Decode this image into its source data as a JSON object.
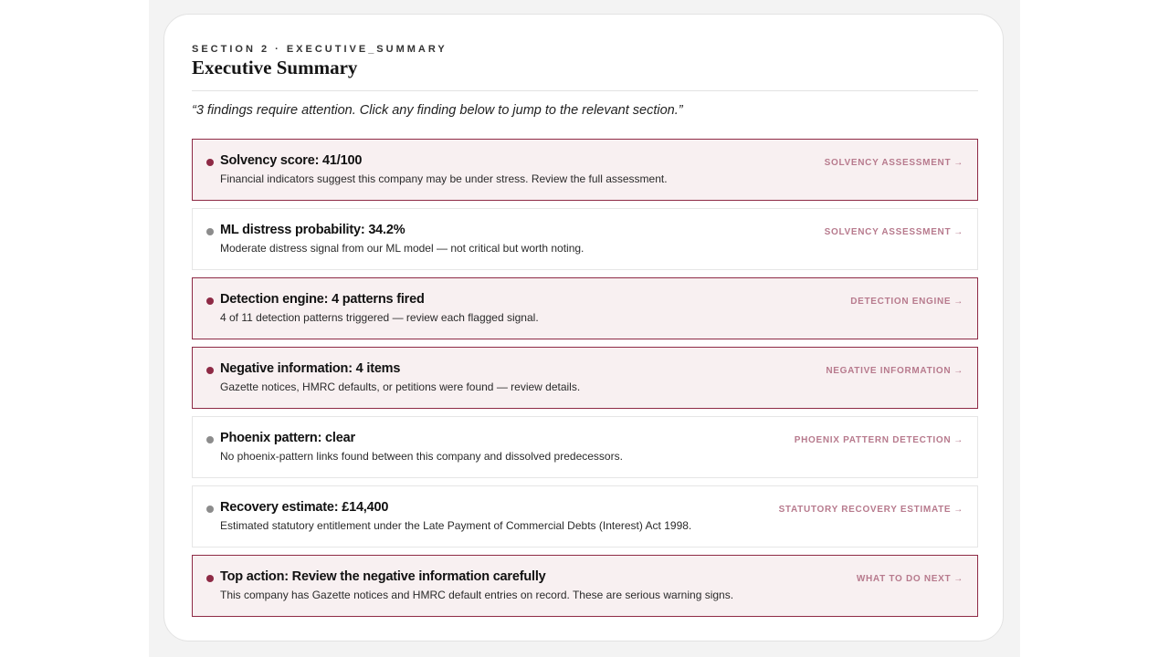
{
  "section": {
    "eyebrow": "SECTION 2 · EXECUTIVE_SUMMARY",
    "title": "Executive Summary",
    "intro": "“3 findings require attention. Click any finding below to jump to the relevant section.”"
  },
  "colors": {
    "alert_accent": "#8e2a45",
    "alert_background": "#f8f0f1",
    "neutral_dot": "#8c8c8c",
    "link_text": "#b77a8d"
  },
  "icons": {
    "finding_dot": "bullet-dot-icon",
    "link_arrow": "arrow-right-icon"
  },
  "findings": [
    {
      "title": "Solvency score: 41/100",
      "description": "Financial indicators suggest this company may be under stress. Review the full assessment.",
      "link": "SOLVENCY ASSESSMENT",
      "highlighted": true
    },
    {
      "title": "ML distress probability: 34.2%",
      "description": "Moderate distress signal from our ML model — not critical but worth noting.",
      "link": "SOLVENCY ASSESSMENT",
      "highlighted": false
    },
    {
      "title": "Detection engine: 4 patterns fired",
      "description": "4 of 11 detection patterns triggered — review each flagged signal.",
      "link": "DETECTION ENGINE",
      "highlighted": true
    },
    {
      "title": "Negative information: 4 items",
      "description": "Gazette notices, HMRC defaults, or petitions were found — review details.",
      "link": "NEGATIVE INFORMATION",
      "highlighted": true
    },
    {
      "title": "Phoenix pattern: clear",
      "description": "No phoenix-pattern links found between this company and dissolved predecessors.",
      "link": "PHOENIX PATTERN DETECTION",
      "highlighted": false
    },
    {
      "title": "Recovery estimate: £14,400",
      "description": "Estimated statutory entitlement under the Late Payment of Commercial Debts (Interest) Act 1998.",
      "link": "STATUTORY RECOVERY ESTIMATE",
      "highlighted": false
    },
    {
      "title": "Top action: Review the negative information carefully",
      "description": "This company has Gazette notices and HMRC default entries on record. These are serious warning signs.",
      "link": "WHAT TO DO NEXT",
      "highlighted": true
    }
  ]
}
